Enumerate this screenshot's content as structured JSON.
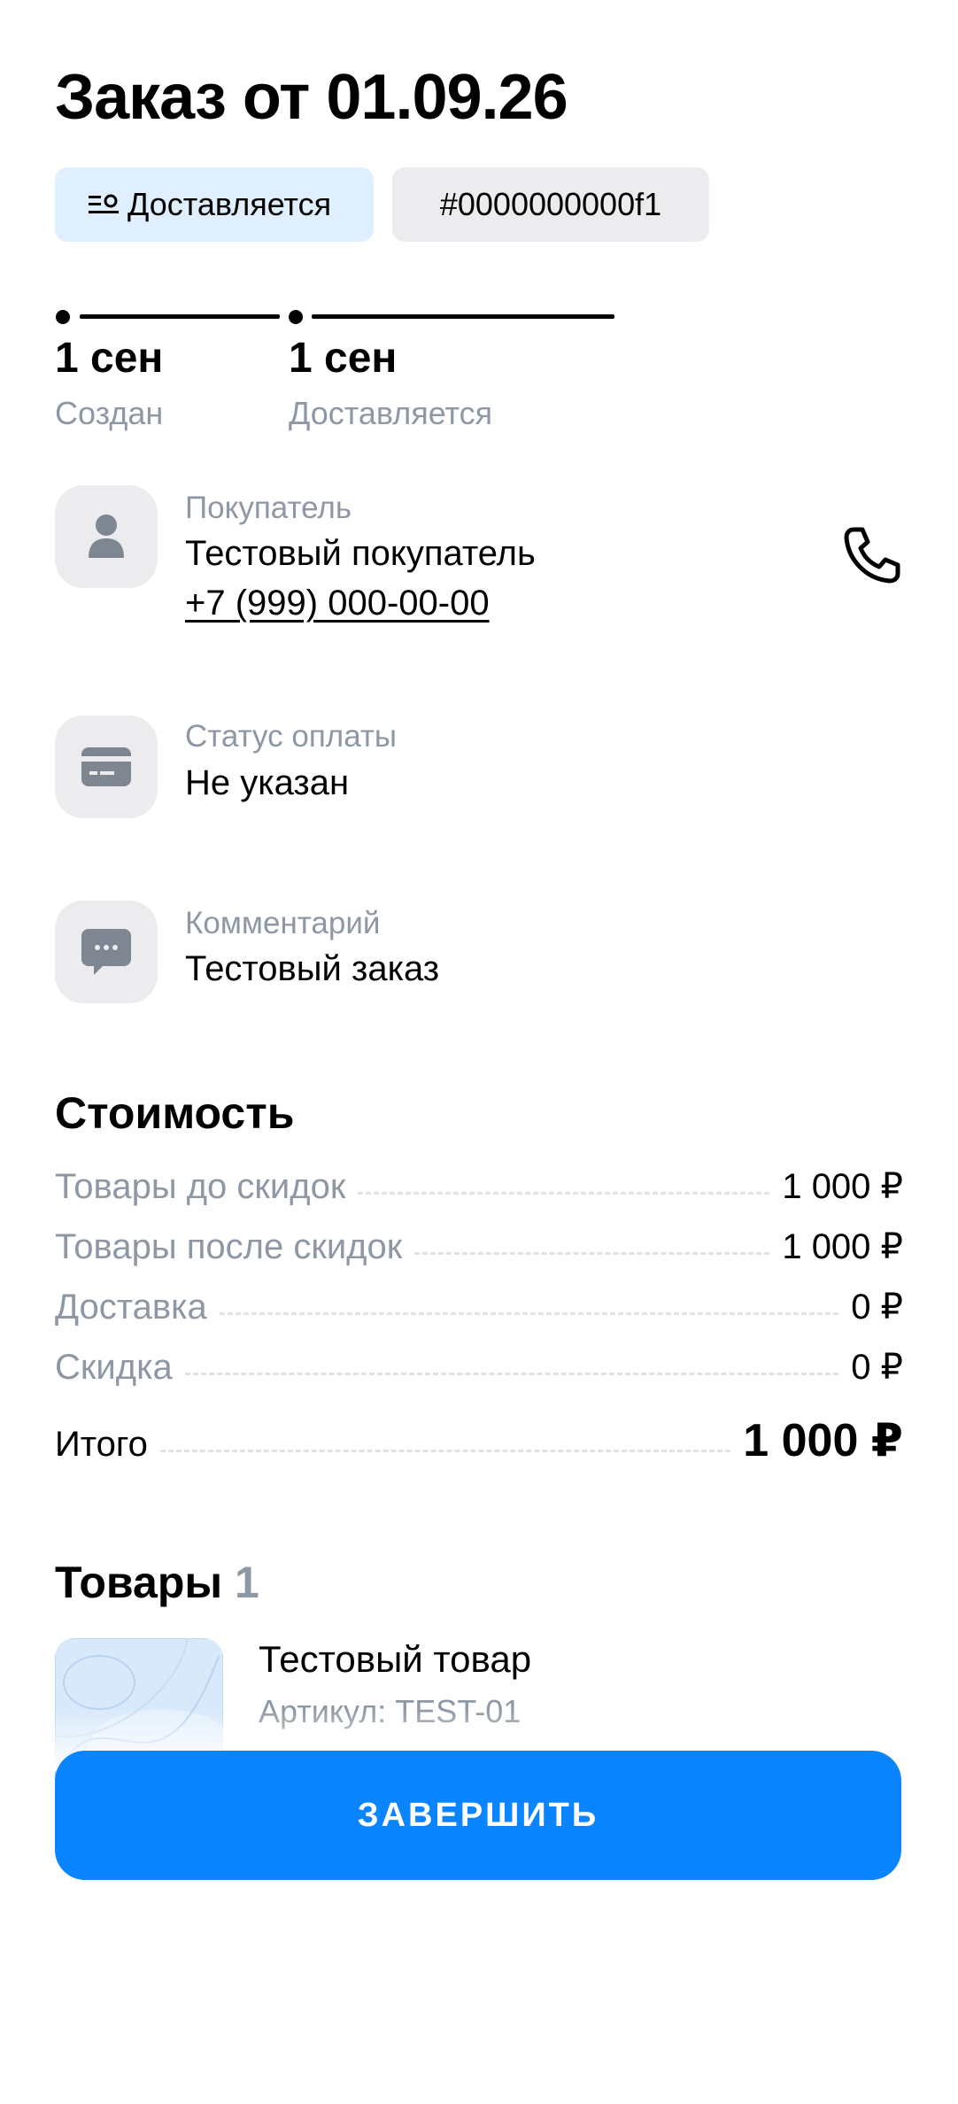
{
  "header": {
    "title": "Заказ от 01.09.26"
  },
  "chips": {
    "status_label": "Доставляется",
    "order_id": "#0000000000f1"
  },
  "timeline": [
    {
      "date": "1 сен",
      "label": "Создан"
    },
    {
      "date": "1 сен",
      "label": "Доставляется"
    }
  ],
  "buyer": {
    "label": "Покупатель",
    "name": "Тестовый покупатель",
    "phone": "+7 (999) 000-00-00"
  },
  "payment": {
    "label": "Статус оплаты",
    "value": "Не указан"
  },
  "comment": {
    "label": "Комментарий",
    "value": "Тестовый заказ"
  },
  "cost": {
    "heading": "Стоимость",
    "rows": [
      {
        "label": "Товары до скидок",
        "value": "1 000 ₽"
      },
      {
        "label": "Товары после скидок",
        "value": "1 000 ₽"
      },
      {
        "label": "Доставка",
        "value": "0 ₽"
      },
      {
        "label": "Скидка",
        "value": "0 ₽"
      }
    ],
    "total_label": "Итого",
    "total_value": "1 000 ₽"
  },
  "products": {
    "heading": "Товары",
    "count": "1",
    "items": [
      {
        "name": "Тестовый товар",
        "sku": "Артикул: TEST-01"
      }
    ]
  },
  "actions": {
    "finish_label": "ЗАВЕРШИТЬ"
  },
  "colors": {
    "accent": "#0a84ff",
    "status_chip_bg": "#e0efff",
    "muted_text": "#8e98a5"
  },
  "icons": {
    "status": "list-status-icon",
    "buyer": "user-icon",
    "phone": "phone-icon",
    "payment": "card-icon",
    "comment": "chat-bubble-icon"
  }
}
